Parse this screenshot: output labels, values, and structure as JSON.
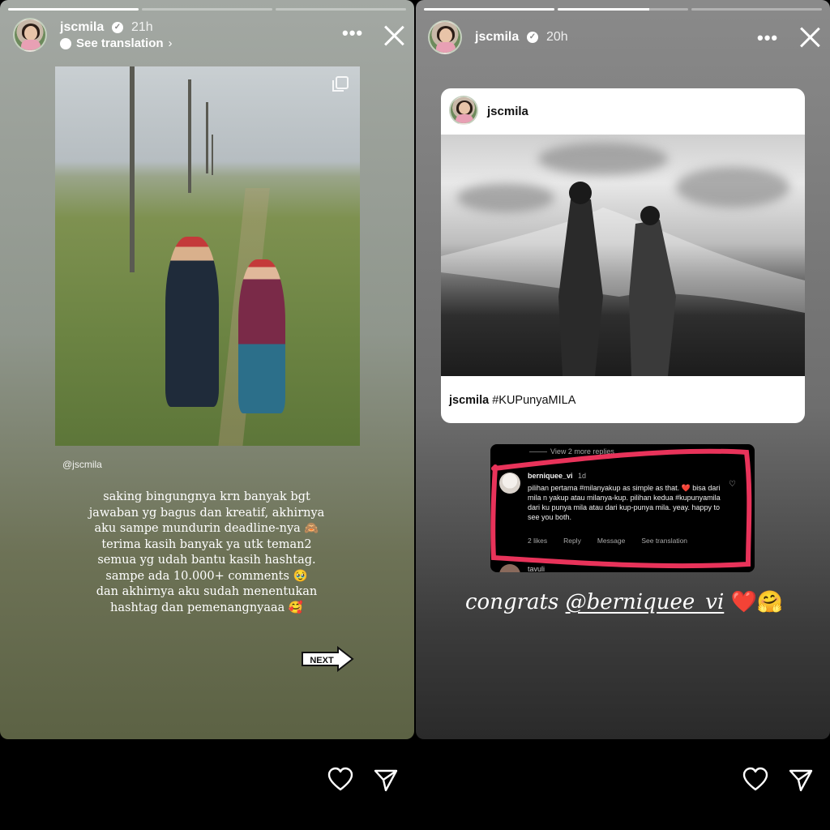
{
  "left_story": {
    "username": "jscmila",
    "time": "21h",
    "translation_label": "See translation",
    "progress": [
      1.0,
      0.0,
      0.0
    ],
    "mention": "@jscmila",
    "caption_lines": [
      "saking bingungnya krn banyak bgt",
      "jawaban yg bagus dan kreatif, akhirnya",
      "aku sampe mundurin deadline-nya 🙈",
      "terima kasih banyak ya utk teman2",
      "semua yg udah bantu kasih hashtag.",
      "sampe ada 10.000+ comments 🥹",
      "dan akhirnya aku sudah menentukan",
      "hashtag dan pemenangnyaaa 🥰"
    ],
    "next_sticker": "NEXT"
  },
  "right_story": {
    "username": "jscmila",
    "time": "20h",
    "progress": [
      1.0,
      0.7,
      0.0
    ],
    "card": {
      "username": "jscmila",
      "caption_user": "jscmila",
      "caption_tag": "#KUPunyaMILA"
    },
    "comment": {
      "view_replies": "View 2 more replies",
      "user": "berniquee_vi",
      "age": "1d",
      "text": "pilihan pertama #milanyakup as simple as that. ❤️ bisa dari mila n yakup atau milanya-kup. pilihan kedua #kupunyamila dari ku punya mila atau dari kup-punya mila. yeay. happy to see you both.",
      "likes": "2 likes",
      "reply": "Reply",
      "message": "Message",
      "see_translation": "See translation",
      "next_user": "tavuli",
      "highlight_color": "#e8335a"
    },
    "congrats_text": "congrats",
    "congrats_mention": "@berniquee_vi",
    "congrats_emojis": "❤️🤗"
  },
  "icons": {
    "like": "heart-icon",
    "share": "send-icon",
    "more": "more-icon",
    "close": "close-icon",
    "verified": "verified-badge-icon"
  }
}
